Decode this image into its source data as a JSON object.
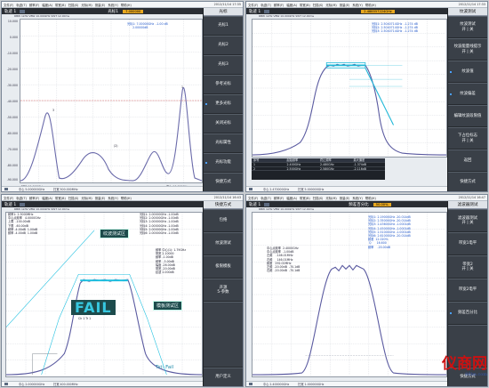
{
  "q1": {
    "menu": [
      "文件(F)",
      "轨迹(T)",
      "频率(F)",
      "幅度(A)",
      "带宽(B)",
      "扫描(S)",
      "光标(M)",
      "测量(E)",
      "系统(Y)",
      "帮助(H)"
    ],
    "date": "2012/11/14 17:35",
    "trace_title": "轨迹 1",
    "marker_name": "光标1",
    "marker_chip": "7.000000",
    "stat": "RBW 1kHz  VBW 10.000kHz  SWT 12.00ms",
    "y_ticks": [
      "10.000",
      "0.000",
      "-10.000",
      "-20.000",
      "-30.000",
      "-40.000",
      "-50.000",
      "-60.000",
      "-70.000",
      "-80.000",
      "-90.000"
    ],
    "marker_readout": "光标1: 7.00000GHz  -1.00 dB\n      2.00000dB",
    "x_start": "起始 10.000MHz",
    "x_stop": "终止 16.000GHz",
    "bottom": [
      "中心  5.000000GHz",
      "扫宽  500.000MHz",
      "分辨带宽 10.0kHz"
    ],
    "marker_labels": [
      "1",
      "(2)",
      "3"
    ],
    "side_title": "光标",
    "side_buttons": [
      "光标1",
      "光标2",
      "光标3",
      "参考光标",
      "更多光标",
      "关闭光标",
      "光标属性",
      "光标功能",
      "快捷方式"
    ]
  },
  "q2": {
    "menu": [
      "文件(F)",
      "轨迹(T)",
      "频率(F)",
      "幅度(A)",
      "带宽(B)",
      "扫描(S)",
      "光标(M)",
      "测量(E)",
      "系统(Y)",
      "帮助(H)"
    ],
    "date": "2012/11/14 17:33",
    "trace_title": "轨迹 1",
    "freq_chip": "2.488557224GHz",
    "stat": "RBW 1kHz  VBW 10.000kHz  SWT 12.00ms",
    "marker_readout": "光标1: 2.5040714GHz  -1.274 dB\n光标2: 2.5040714GHz  -1.274 dB\n光标3: 2.5040714GHz  -1.274 dB",
    "table_header": [
      "序号",
      "起始频率",
      "终止频率",
      "最大偏差"
    ],
    "table_rows": [
      [
        "1",
        "2.400GHz",
        "2.480GHz",
        "-1.374dB"
      ],
      [
        "2",
        "2.500GHz",
        "2.580GHz",
        "-2.116dB"
      ]
    ],
    "bottom": [
      "中心  2.470000GHz",
      "扫宽  5.000000GHz",
      "终止  7.968000GHz"
    ],
    "side_title": "纹波测试",
    "side_buttons": [
      "纹波测试\n开 | 关",
      "纹波能量线提示\n开 | 关",
      "纹波值",
      "纹波偏差",
      "编辑纹波段限值",
      "下占位标志\n开 | 关",
      "返回",
      "快捷方式"
    ]
  },
  "q3": {
    "menu": [
      "文件(F)",
      "轨迹(T)",
      "频率(F)",
      "幅度(A)",
      "带宽(B)",
      "扫描(S)",
      "光标(M)",
      "测量(E)",
      "系统(Y)",
      "帮助(H)"
    ],
    "date": "2012/11/14 16:43",
    "trace_title": "轨迹 1",
    "stat": "RBW 1kHz  VBW 10.000kHz  SWT 12.00ms",
    "left_readout": "频率1: 2.3000MHz\n中心点频率   4.0000GHz\n上限  -100.00dB\n下限  -60.00dB\n频率 -4.00dB  1.00dB\n频率 -4.00dB  1.00dB",
    "right_readout": "光标1: 2.00000GHz -1.00dB\n光标2: 2.00000GHz -1.00dB\n光标3: 2.00000GHz -1.00dB\n光标4: 2.00000GHz -1.00dB\n光标5: 2.00000GHz -1.00dB\n光标6: 2.00000GHz -1.00dB",
    "side_readout": "频率 中心(1): 1.79GHz\n带宽 2.10000\n频率 -1.00dB\n频率  -3.00dB\n幅度 -26.00dB\n带宽 -20.00dB\n纹波 2.000dB",
    "callout_ripple": "纹波测试区",
    "callout_limit": "模板测试区",
    "fail_text": "FAIL",
    "fail_sub": "Ch 1 Tr 1",
    "tst_result": "Tst: Fail",
    "bottom": [
      "中心  2.000000GHz",
      "扫宽  400.000MHz",
      "终止 2.400000GHz"
    ],
    "side_title": "快捷方式",
    "side_buttons": [
      "包络",
      "纹波测试",
      "极限模板",
      "开源\n5-参数",
      "用户定义"
    ]
  },
  "q4": {
    "menu": [
      "文件(F)",
      "轨迹(T)",
      "频率(F)",
      "幅度(A)",
      "带宽(B)",
      "扫描(S)",
      "光标(M)",
      "测量(E)",
      "系统(Y)",
      "帮助(H)"
    ],
    "date": "2012/11/14 16:47",
    "trace_title": "轨迹 1",
    "mode_label": "频差百分比",
    "mode_chip": "50.00%",
    "stat": "RBW 1kHz  VBW 10.000kHz  SWT 12.00ms",
    "left_readout": "中心点频率  2.4000GHz\n中心点频率  -1.00dB\n左频    -146.01MHz\n右频     146.01MHz\n频差   292.02MHz\n左频  -20.00dB  -70.1dB\n右频  -20.00dB  -70.1dB",
    "right_readout": "光标1: 2.19000GHz -20.014dB\n光标2: 2.35000GHz -20.014dB\n光标3: 2.43600GHz -1.0001dB\n光标4: 2.45000GHz -1.0001dB\n光标5: 2.51000GHz -1.0001dB\n光标6: 2.61000GHz -20.014dB\n频差  12.020%\n Q      16.600\n频率    -20.00dB",
    "bottom": [
      "中心  2.400000GHz",
      "扫宽  1.000000GHz",
      "终止  2.900000GHz"
    ],
    "side_title": "滤波器测试",
    "side_buttons": [
      "滤波器测试\n开 | 关",
      "带宽1电平",
      "带宽2\n开 | 关",
      "带宽2电平",
      "频差百分比",
      "快捷方式"
    ]
  },
  "watermark": {
    "brand": "仪商网",
    "url": "86lm.com"
  }
}
